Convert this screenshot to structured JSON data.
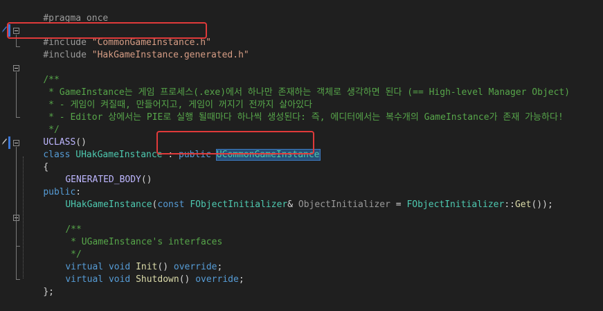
{
  "lines": {
    "l1_pragma": "#pragma once",
    "l3_include_kw": "#include",
    "l3_include_str": "\"CommonGameInstance.h\"",
    "l4_include_kw": "#include",
    "l4_include_str": "\"HakGameInstance.generated.h\"",
    "l6_comment": "/**",
    "l7_comment": " * GameInstance는 게임 프로세스(.exe)에서 하나만 존재하는 객체로 생각하면 된다 (== High-level Manager Object)",
    "l8_comment": " * - 게임이 켜질때, 만들어지고, 게임이 꺼지기 전까지 살아있다",
    "l9_comment": " * - Editor 상에서는 PIE로 실행 될때마다 하나씩 생성된다: 즉, 에디터에서는 복수개의 GameInstance가 존재 가능하다!",
    "l10_comment": " */",
    "l11_macro": "UCLASS",
    "l11_paren": "()",
    "l12_class_kw": "class",
    "l12_class_name": "UHakGameInstance",
    "l12_colon": " : ",
    "l12_public_kw": "public",
    "l12_base": "UCommonGameInstance",
    "l13_brace": "{",
    "l14_macro": "GENERATED_BODY",
    "l14_paren": "()",
    "l15_public": "public",
    "l15_colon": ":",
    "l16_fn": "UHakGameInstance",
    "l16_open": "(",
    "l16_const": "const",
    "l16_type": "FObjectInitializer",
    "l16_amp": "& ",
    "l16_param": "ObjectInitializer",
    "l16_eq": " = ",
    "l16_type2": "FObjectInitializer",
    "l16_scope": "::",
    "l16_get": "Get",
    "l16_close": "());",
    "l18_comment": "/**",
    "l19_comment": " * UGameInstance's interfaces",
    "l20_comment": " */",
    "l21_virtual": "virtual",
    "l21_void": "void",
    "l21_fn": "Init",
    "l21_paren": "()",
    "l21_override": "override",
    "l21_semi": ";",
    "l22_virtual": "virtual",
    "l22_void": "void",
    "l22_fn": "Shutdown",
    "l22_paren": "()",
    "l22_override": "override",
    "l22_semi": ";",
    "l23_close": "};"
  },
  "colors": {
    "background": "#1f1f1f",
    "keyword": "#569cd6",
    "type": "#4ec9b0",
    "function": "#dcdcaa",
    "string": "#d69d85",
    "comment": "#57a64a",
    "macro": "#beb7ff",
    "highlight_box": "#e03a3a"
  },
  "icons": {
    "edit_marker": "pencil-icon",
    "fold_toggle": "collapse-icon"
  }
}
